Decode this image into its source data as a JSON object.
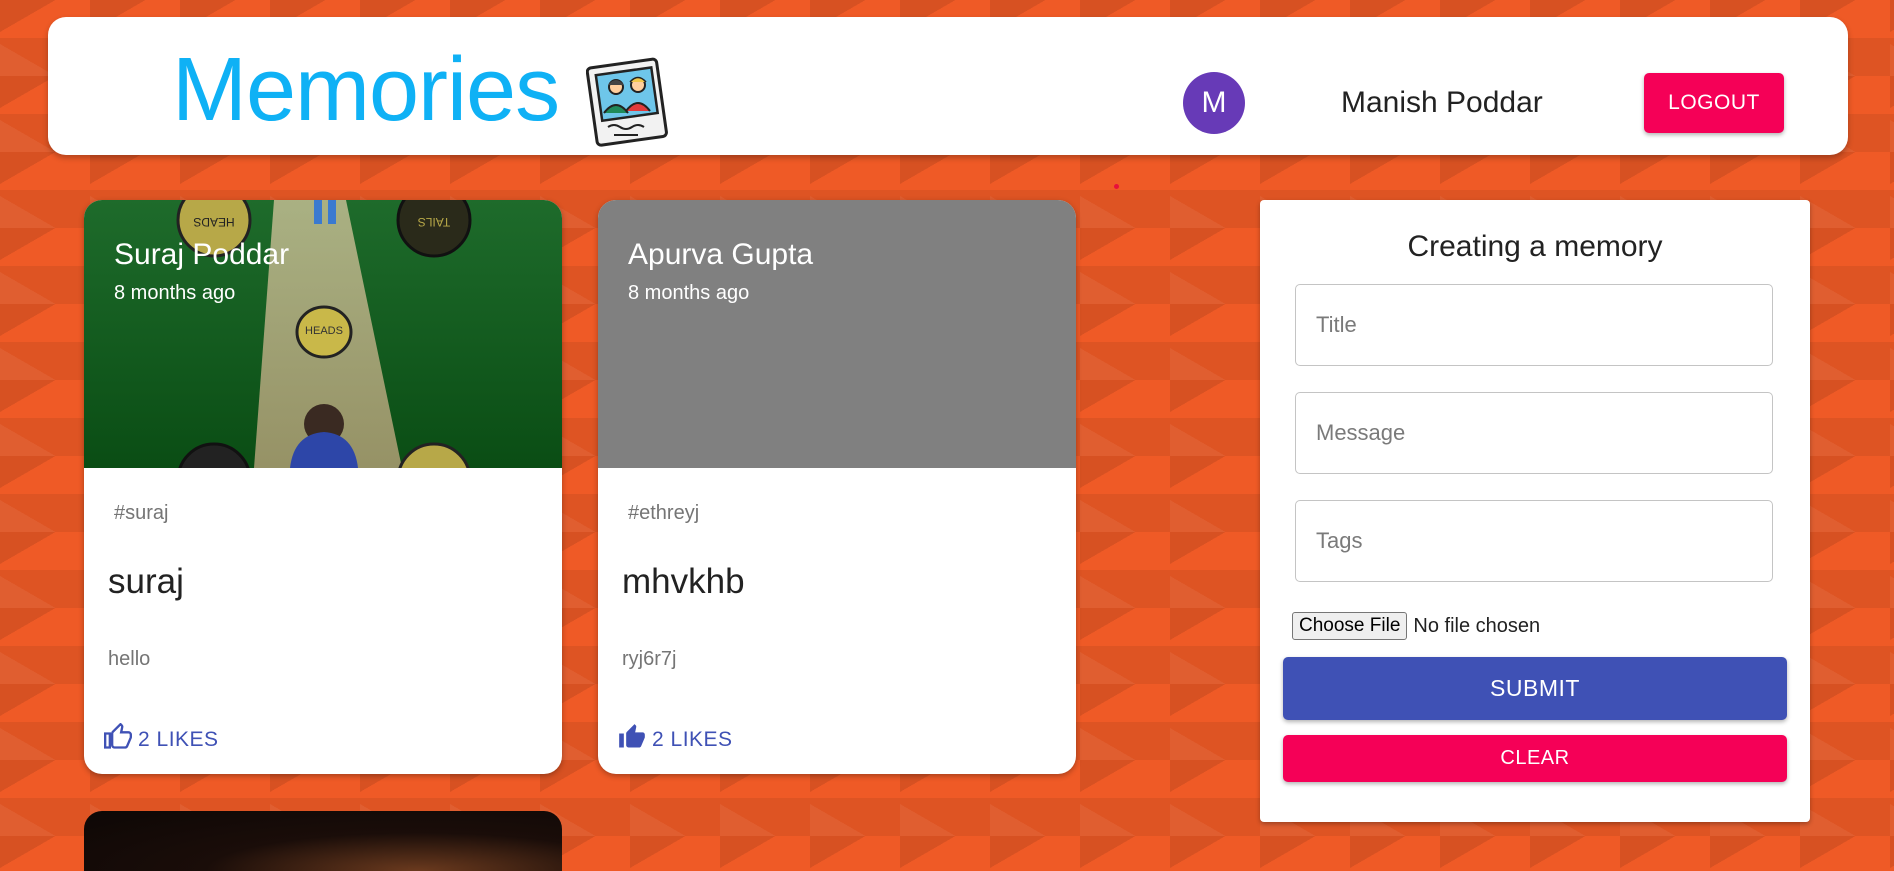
{
  "header": {
    "brand_title": "Memories",
    "brand_logo_icon": "photo-memories-icon",
    "avatar_initial": "M",
    "avatar_color": "#673ab7",
    "username": "Manish Poddar",
    "logout_label": "LOGOUT"
  },
  "posts": [
    {
      "author": "Suraj Poddar",
      "time": "8 months ago",
      "tags": "#suraj",
      "title": "suraj",
      "message": "hello",
      "likes_label": "2 LIKES",
      "like_icon": "thumb-up-outline-icon",
      "media": "coin-toss-image"
    },
    {
      "author": "Apurva Gupta",
      "time": "8 months ago",
      "tags": "#ethreyj",
      "title": "mhvkhb",
      "message": "ryj6r7j",
      "likes_label": "2 LIKES",
      "like_icon": "thumb-up-filled-icon",
      "media": "grey-placeholder"
    }
  ],
  "form": {
    "heading": "Creating a memory",
    "title_placeholder": "Title",
    "message_placeholder": "Message",
    "tags_placeholder": "Tags",
    "file_button_label": "Choose File",
    "file_status": "No file chosen",
    "submit_label": "SUBMIT",
    "clear_label": "CLEAR"
  },
  "colors": {
    "brand": "#0fb1f5",
    "primary": "#3f51b5",
    "secondary": "#f50057",
    "background": "#ef5a26"
  }
}
